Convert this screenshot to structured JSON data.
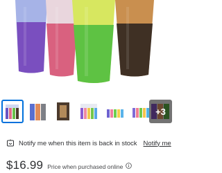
{
  "product": {
    "hero_image": {
      "name": "color-changing-tumblers-image"
    },
    "thumbnails": [
      {
        "name": "thumbnail-1",
        "selected": true
      },
      {
        "name": "thumbnail-2",
        "selected": false
      },
      {
        "name": "thumbnail-3",
        "selected": false
      },
      {
        "name": "thumbnail-4",
        "selected": false
      },
      {
        "name": "thumbnail-5",
        "selected": false
      },
      {
        "name": "thumbnail-6",
        "selected": false
      },
      {
        "name": "thumbnail-more",
        "selected": false,
        "overlay_label": "+3"
      }
    ]
  },
  "stock_alert": {
    "icon": "bell-icon",
    "text": "Notify me when this item is back in stock",
    "link_label": "Notify me"
  },
  "pricing": {
    "price": "$16.99",
    "note": "Price when purchased online",
    "info_icon": "info-icon"
  },
  "colors": {
    "selected_border": "#0071dc",
    "text": "#2e2f32"
  }
}
